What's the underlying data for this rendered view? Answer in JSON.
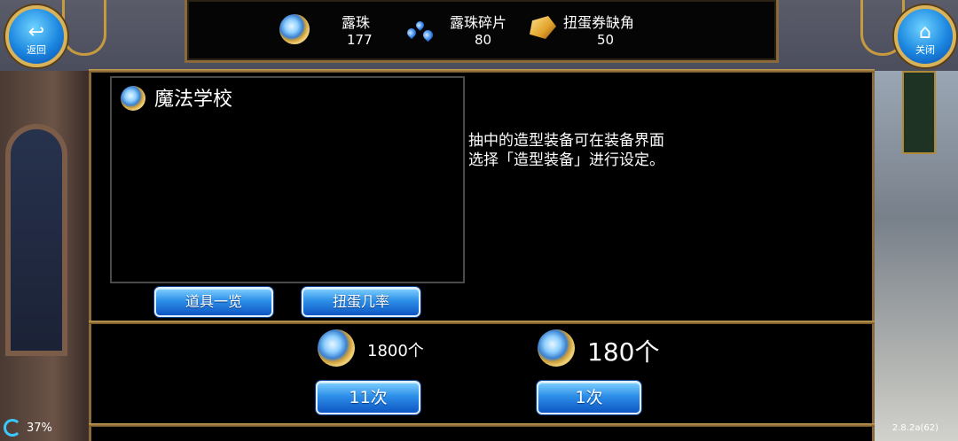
{
  "header": {
    "back_label": "返回",
    "close_label": "关闭",
    "currencies": [
      {
        "label": "露珠",
        "count": "177",
        "icon": "dew-orb-icon"
      },
      {
        "label": "露珠碎片",
        "count": "80",
        "icon": "dew-fragment-icon"
      },
      {
        "label": "扭蛋券缺角",
        "count": "50",
        "icon": "gacha-ticket-fragment-icon"
      }
    ]
  },
  "gacha": {
    "title": "魔法学校",
    "info_line1": "抽中的造型装备可在装备界面",
    "info_line2": "选择「造型装备」进行设定。",
    "item_list_label": "道具一览",
    "rates_label": "扭蛋几率"
  },
  "draw": {
    "multi_cost": "1800个",
    "single_cost": "180个",
    "multi_label": "11次",
    "single_label": "1次"
  },
  "footer": {
    "loading_percent": "37%",
    "version": "2.8.2a(62)"
  },
  "colors": {
    "button_blue": "#2d8fe8",
    "gold_frame": "#caa35a",
    "panel_bg": "#000000"
  }
}
